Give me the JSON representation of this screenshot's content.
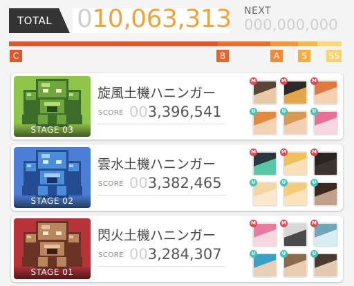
{
  "header": {
    "total_label": "TOTAL",
    "total_lead": "0",
    "total_value": "10,063,313",
    "next_label": "NEXT",
    "next_value": "000,000,000"
  },
  "rank_bar": {
    "progress": 0.61,
    "ranks": [
      "C",
      "B",
      "A",
      "S",
      "SS"
    ],
    "colors": {
      "C": "#e0562b",
      "B": "#e86a2b",
      "A": "#f08a36",
      "S": "#f7b341",
      "SS": "#fbd66d"
    }
  },
  "stages": [
    {
      "stage_label": "STAGE 03",
      "boss_name": "旋風土機ハニンガー",
      "score_label": "SCORE",
      "score_lead": "00",
      "score_value": "3,396,541",
      "boss_color": "green",
      "team": [
        "M",
        "M",
        "M",
        "U",
        "U",
        "U"
      ]
    },
    {
      "stage_label": "STAGE 02",
      "boss_name": "雲水土機ハニンガー",
      "score_label": "SCORE",
      "score_lead": "00",
      "score_value": "3,382,465",
      "boss_color": "blue",
      "team": [
        "M",
        "M",
        "M",
        "U",
        "U",
        "U"
      ]
    },
    {
      "stage_label": "STAGE 01",
      "boss_name": "閃火土機ハニンガー",
      "score_label": "SCORE",
      "score_lead": "00",
      "score_value": "3,284,307",
      "boss_color": "red",
      "team": [
        "M",
        "M",
        "M",
        "U",
        "U",
        "U"
      ]
    }
  ]
}
